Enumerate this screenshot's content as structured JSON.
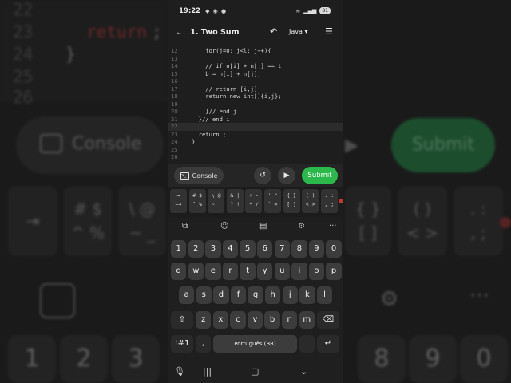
{
  "background": {
    "code_lines": [
      {
        "num": "22",
        "text": ""
      },
      {
        "num": "23",
        "keyword": "return",
        "text": " ;"
      },
      {
        "num": "24",
        "text": "}"
      },
      {
        "num": "25",
        "text": ""
      },
      {
        "num": "26",
        "text": ""
      }
    ],
    "console_label": "Console",
    "submit_label": "Submit",
    "symbol_keys": [
      "\\ @",
      "# $",
      "^ %",
      "~ _",
      "{ }",
      "[ ]",
      "( )",
      "< >",
      ". :",
      ", ;"
    ],
    "num_keys": [
      "1",
      "2",
      "3",
      "8",
      "9",
      "0"
    ]
  },
  "status_bar": {
    "time": "19:22",
    "battery": "81"
  },
  "header": {
    "title": "1. Two Sum",
    "language": "Java"
  },
  "editor": {
    "lines": [
      {
        "num": "12",
        "code": "    for(j=0; j<l; j++){",
        "style": "normal"
      },
      {
        "num": "13",
        "code": "",
        "style": "normal"
      },
      {
        "num": "14",
        "code": "    // if n[i] + n[j] == t",
        "style": "comment"
      },
      {
        "num": "15",
        "code": "    b = n[i] + n[j];",
        "style": "normal"
      },
      {
        "num": "16",
        "code": "",
        "style": "normal"
      },
      {
        "num": "17",
        "code": "    // return [i,j]",
        "style": "comment"
      },
      {
        "num": "18",
        "code": "    return new int[]{i,j};",
        "style": "return"
      },
      {
        "num": "19",
        "code": "",
        "style": "normal"
      },
      {
        "num": "20",
        "code": "    }// end j",
        "style": "normal"
      },
      {
        "num": "21",
        "code": "  }// end i",
        "style": "normal"
      },
      {
        "num": "22",
        "code": "",
        "style": "current"
      },
      {
        "num": "23",
        "code": "  return ;",
        "style": "return2"
      },
      {
        "num": "24",
        "code": "}",
        "style": "normal"
      },
      {
        "num": "25",
        "code": "",
        "style": "normal"
      },
      {
        "num": "26",
        "code": "",
        "style": "normal"
      }
    ]
  },
  "actions": {
    "console_label": "Console",
    "submit_label": "Submit"
  },
  "symbol_row": [
    {
      "top": "⇥",
      "bottom": "←→"
    },
    {
      "top": "# $",
      "bottom": "^ %"
    },
    {
      "top": "\\ @",
      "bottom": "~ _"
    },
    {
      "top": "& |",
      "bottom": "? !"
    },
    {
      "top": "+ -",
      "bottom": "* /"
    },
    {
      "top": "' \"",
      "bottom": "` ="
    },
    {
      "top": "{ }",
      "bottom": "[ ]"
    },
    {
      "top": "( )",
      "bottom": "< >"
    },
    {
      "top": ". :",
      "bottom": ", ;"
    }
  ],
  "keyboard": {
    "row_numbers": [
      "1",
      "2",
      "3",
      "4",
      "5",
      "6",
      "7",
      "8",
      "9",
      "0"
    ],
    "row1": [
      "q",
      "w",
      "e",
      "r",
      "t",
      "y",
      "u",
      "i",
      "o",
      "p"
    ],
    "row2": [
      "a",
      "s",
      "d",
      "f",
      "g",
      "h",
      "j",
      "k",
      "l"
    ],
    "row3": [
      "z",
      "x",
      "c",
      "v",
      "b",
      "n",
      "m"
    ],
    "symbols_key": "!#1",
    "comma_key": ",",
    "space_label": "Português (BR)",
    "period_key": "."
  },
  "colors": {
    "submit": "#2cb94b",
    "keyword": "#e06c75",
    "comment": "#7f8794"
  }
}
